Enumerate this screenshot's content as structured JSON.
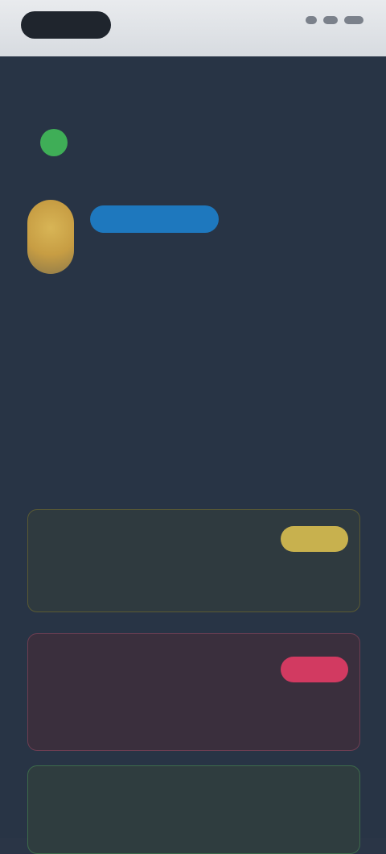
{
  "status_bar": {
    "left_pill": "",
    "right_icons": [
      "signal-icon",
      "wifi-icon",
      "battery-icon"
    ]
  },
  "profile": {
    "title": "",
    "description_line_1": "",
    "description_line_2": "",
    "status_color": "#3fae57",
    "avatar_color": "#d8b556"
  },
  "info": {
    "line_1": "",
    "line_2": "",
    "line_3": ""
  },
  "section": {
    "title": ""
  },
  "cards": [
    {
      "label": "",
      "badge": "",
      "body": "",
      "accent": "#d7c553"
    },
    {
      "label": "",
      "badge": "",
      "body": "",
      "accent": "#d64c69"
    },
    {
      "label": "",
      "body": "",
      "accent": "#58b46b"
    }
  ]
}
